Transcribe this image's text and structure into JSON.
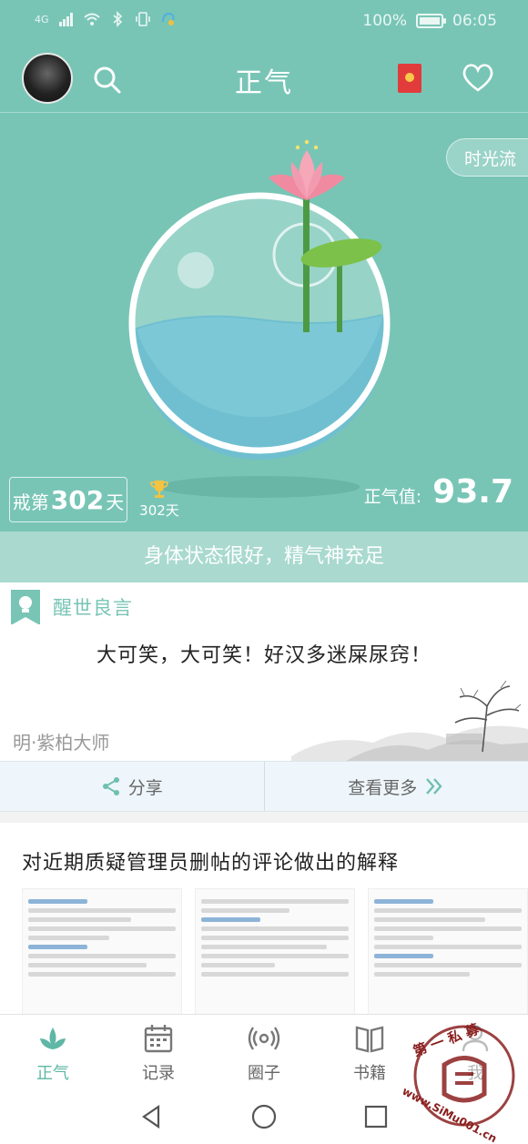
{
  "statusbar": {
    "network": "4G",
    "battery": "100%",
    "battery_level": 1.0,
    "time": "06:05"
  },
  "header": {
    "title": "正气",
    "icons": [
      "avatar",
      "search-icon",
      "red-packet-icon",
      "heart-icon"
    ]
  },
  "hero": {
    "timeflow_label": "时光流",
    "quit_prefix": "戒第",
    "quit_days": "302",
    "quit_suffix": "天",
    "trophy_days": "302天",
    "zq_label": "正气值:",
    "zq_value": "93.7",
    "status_text": "身体状态很好，精气神充足"
  },
  "quote_card": {
    "title": "醒世良言",
    "quote": "大可笑，大可笑！好汉多迷屎尿窍！",
    "author": "明·紫柏大师",
    "share_label": "分享",
    "more_label": "查看更多"
  },
  "post_card": {
    "title": "对近期质疑管理员删帖的评论做出的解释"
  },
  "tabbar": {
    "items": [
      {
        "label": "正气",
        "icon": "lotus-icon",
        "active": true
      },
      {
        "label": "记录",
        "icon": "calendar-icon",
        "active": false
      },
      {
        "label": "圈子",
        "icon": "broadcast-icon",
        "active": false
      },
      {
        "label": "书籍",
        "icon": "book-icon",
        "active": false
      },
      {
        "label": "我",
        "icon": "user-icon",
        "active": false
      }
    ]
  },
  "watermark": {
    "text_top": "第 一 私 募",
    "text_bottom": "www.SiMu001.cn"
  },
  "colors": {
    "teal": "#78c5b6",
    "teal_light": "#a9d9cf",
    "active_tab": "#5fb7a5"
  }
}
